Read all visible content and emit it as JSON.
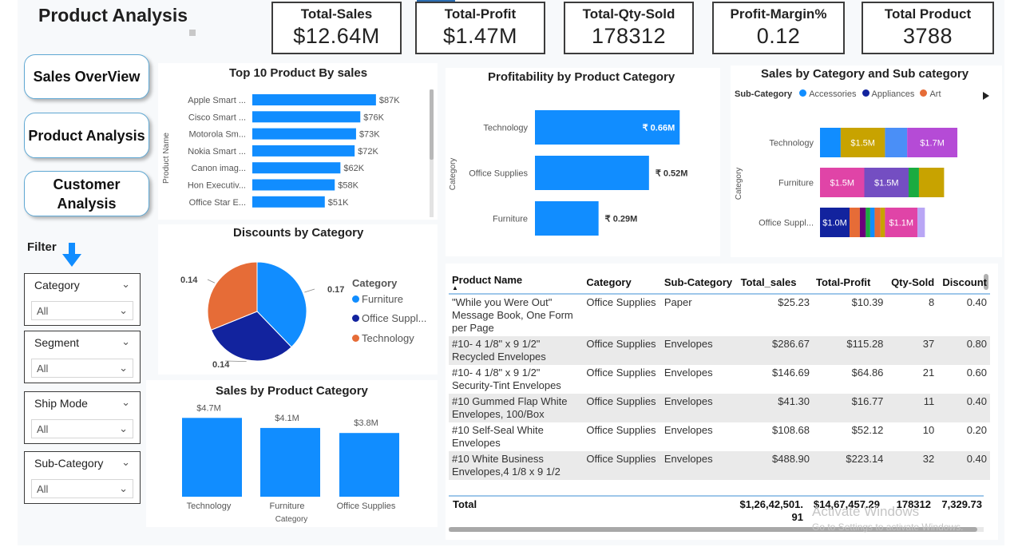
{
  "page": {
    "title": "Product Analysis",
    "watermark_line1": "Activate Windows",
    "watermark_line2": "Go to Settings to activate Windows."
  },
  "kpis": [
    {
      "label": "Total-Sales",
      "value": "$12.64M"
    },
    {
      "label": "Total-Profit",
      "value": "$1.47M"
    },
    {
      "label": "Total-Qty-Sold",
      "value": "178312"
    },
    {
      "label": "Profit-Margin%",
      "value": "0.12"
    },
    {
      "label": "Total Product",
      "value": "3788"
    }
  ],
  "nav": {
    "sales_overview": "Sales OverView",
    "product_analysis": "Product Analysis",
    "customer_analysis": "Customer Analysis"
  },
  "filters": {
    "label": "Filter",
    "items": [
      {
        "title": "Category",
        "value": "All"
      },
      {
        "title": "Segment",
        "value": "All"
      },
      {
        "title": "Ship Mode",
        "value": "All"
      },
      {
        "title": "Sub-Category",
        "value": "All"
      }
    ]
  },
  "colors": {
    "accent": "#118DFF",
    "dark_blue": "#12239E",
    "orange": "#E66C37",
    "gold": "#C8A300",
    "purple": "#B54BD6",
    "magenta": "#E044A7",
    "violet": "#744EC2",
    "green": "#1AAB40"
  },
  "chart_data": [
    {
      "id": "top10",
      "type": "bar",
      "orientation": "horizontal",
      "title": "Top 10 Product By sales",
      "ylabel": "Product Name",
      "categories": [
        "Apple Smart ...",
        "Cisco Smart ...",
        "Motorola Sm...",
        "Nokia Smart ...",
        "Canon imag...",
        "Hon Executiv...",
        "Office Star E..."
      ],
      "values": [
        87,
        76,
        73,
        72,
        62,
        58,
        51
      ],
      "labels": [
        "$87K",
        "$76K",
        "$73K",
        "$72K",
        "$62K",
        "$58K",
        "$51K"
      ],
      "xlim": [
        0,
        100
      ]
    },
    {
      "id": "profitability",
      "type": "bar",
      "orientation": "horizontal",
      "title": "Profitability by Product Category",
      "ylabel": "Category",
      "categories": [
        "Technology",
        "Office Supplies",
        "Furniture"
      ],
      "values": [
        0.66,
        0.52,
        0.29
      ],
      "labels": [
        "₹ 0.66M",
        "₹ 0.52M",
        "₹ 0.29M"
      ],
      "xlim": [
        0,
        0.75
      ]
    },
    {
      "id": "subcat",
      "type": "bar",
      "orientation": "horizontal",
      "stacked": true,
      "title": "Sales by Category and Sub category",
      "ylabel": "Category",
      "legend_title": "Sub-Category",
      "legend": [
        {
          "name": "Accessories",
          "color": "#118DFF"
        },
        {
          "name": "Appliances",
          "color": "#12239E"
        },
        {
          "name": "Art",
          "color": "#E66C37"
        }
      ],
      "categories": [
        "Technology",
        "Furniture",
        "Office Suppl..."
      ],
      "stacks": [
        [
          {
            "value": 0.7,
            "color": "#118DFF",
            "label": ""
          },
          {
            "value": 1.5,
            "color": "#C8A300",
            "label": "$1.5M"
          },
          {
            "value": 0.75,
            "color": "#4A8FF7",
            "label": ""
          },
          {
            "value": 1.7,
            "color": "#B54BD6",
            "label": "$1.7M"
          }
        ],
        [
          {
            "value": 1.5,
            "color": "#E044A7",
            "label": "$1.5M"
          },
          {
            "value": 1.5,
            "color": "#744EC2",
            "label": "$1.5M"
          },
          {
            "value": 0.35,
            "color": "#1AAB40",
            "label": ""
          },
          {
            "value": 0.85,
            "color": "#C8A300",
            "label": ""
          }
        ],
        [
          {
            "value": 1.0,
            "color": "#12239E",
            "label": "$1.0M"
          },
          {
            "value": 0.35,
            "color": "#E66C37",
            "label": ""
          },
          {
            "value": 0.2,
            "color": "#6B007B",
            "label": ""
          },
          {
            "value": 0.15,
            "color": "#1AAB40",
            "label": ""
          },
          {
            "value": 0.15,
            "color": "#118DFF",
            "label": ""
          },
          {
            "value": 0.2,
            "color": "#E66C37",
            "label": ""
          },
          {
            "value": 0.15,
            "color": "#C8A300",
            "label": ""
          },
          {
            "value": 1.1,
            "color": "#E044A7",
            "label": "$1.1M"
          },
          {
            "value": 0.25,
            "color": "#B9A6F5",
            "label": ""
          }
        ]
      ]
    },
    {
      "id": "discounts",
      "type": "pie",
      "title": "Discounts by Category",
      "legend_title": "Category",
      "slices": [
        {
          "name": "Furniture",
          "value": 0.17,
          "color": "#118DFF"
        },
        {
          "name": "Office Suppl...",
          "value": 0.14,
          "color": "#12239E"
        },
        {
          "name": "Technology",
          "value": 0.14,
          "color": "#E66C37"
        }
      ],
      "labels": [
        "0.17",
        "0.14",
        "0.14"
      ]
    },
    {
      "id": "sales_cat",
      "type": "bar",
      "title": "Sales by Product Category",
      "xlabel": "Category",
      "categories": [
        "Technology",
        "Furniture",
        "Office Supplies"
      ],
      "values": [
        4.7,
        4.1,
        3.8
      ],
      "labels": [
        "$4.7M",
        "$4.1M",
        "$3.8M"
      ],
      "ylim": [
        0,
        5
      ]
    }
  ],
  "table": {
    "columns": [
      "Product Name",
      "Category",
      "Sub-Category",
      "Total_sales",
      "Total-Profit",
      "Qty-Sold",
      "Discount"
    ],
    "rows": [
      [
        "\"While you Were Out\" Message Book, One Form per Page",
        "Office Supplies",
        "Paper",
        "$25.23",
        "$10.39",
        "8",
        "0.40"
      ],
      [
        "#10- 4 1/8\" x 9 1/2\" Recycled Envelopes",
        "Office Supplies",
        "Envelopes",
        "$286.67",
        "$115.28",
        "37",
        "0.80"
      ],
      [
        "#10- 4 1/8\" x 9 1/2\" Security-Tint Envelopes",
        "Office Supplies",
        "Envelopes",
        "$146.69",
        "$64.86",
        "21",
        "0.60"
      ],
      [
        "#10 Gummed Flap White Envelopes, 100/Box",
        "Office Supplies",
        "Envelopes",
        "$41.30",
        "$16.77",
        "11",
        "0.40"
      ],
      [
        "#10 Self-Seal White Envelopes",
        "Office Supplies",
        "Envelopes",
        "$108.68",
        "$52.12",
        "10",
        "0.20"
      ],
      [
        "#10 White Business Envelopes,4 1/8 x 9 1/2",
        "Office Supplies",
        "Envelopes",
        "$488.90",
        "$223.14",
        "32",
        "0.40"
      ]
    ],
    "total_label": "Total",
    "total_sales": "$1,26,42,501.91",
    "total_profit": "$14,67,457.29",
    "total_qty": "178312",
    "total_discount": "7,329.73"
  }
}
